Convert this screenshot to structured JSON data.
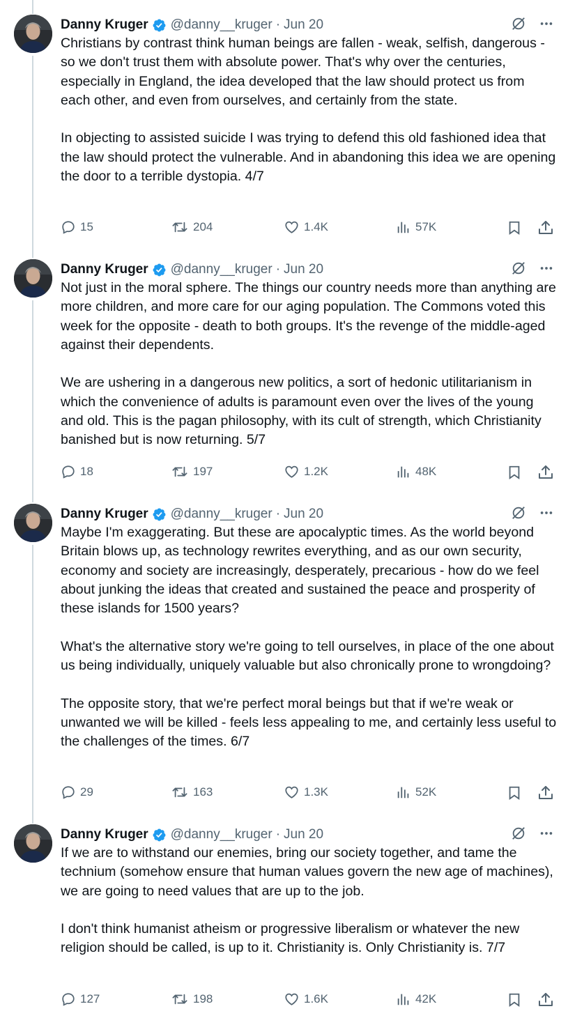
{
  "tweets": [
    {
      "name": "Danny Kruger",
      "handle": "@danny__kruger",
      "separator": "·",
      "date": "Jun 20",
      "paragraphs": [
        "Christians by contrast think human beings are fallen - weak, selfish, dangerous - so we don't trust them with absolute power. That's why over the centuries, especially in England, the idea developed that the law should protect us from each other, and even from ourselves, and certainly from the state.",
        "In objecting to assisted suicide I was trying to defend this old fashioned idea that the law should protect the vulnerable. And in abandoning this idea we are opening the door to a terrible dystopia. 4/7"
      ],
      "replies": "15",
      "reposts": "204",
      "likes": "1.4K",
      "views": "57K"
    },
    {
      "name": "Danny Kruger",
      "handle": "@danny__kruger",
      "separator": "·",
      "date": "Jun 20",
      "paragraphs": [
        "Not just in the moral sphere. The things our country needs more than anything are more children, and more care for our aging population. The Commons voted this week for the opposite - death to both groups. It's the revenge of the middle-aged against their dependents.",
        "We are ushering in a dangerous new politics, a sort of hedonic utilitarianism in which the convenience of adults is paramount even over the lives of the young and old. This is the pagan philosophy, with its cult of strength, which Christianity banished but is now returning. 5/7"
      ],
      "replies": "18",
      "reposts": "197",
      "likes": "1.2K",
      "views": "48K"
    },
    {
      "name": "Danny Kruger",
      "handle": "@danny__kruger",
      "separator": "·",
      "date": "Jun 20",
      "paragraphs": [
        "Maybe I'm exaggerating. But these are apocalyptic times. As the world beyond Britain blows up, as technology rewrites everything, and as our own security, economy and society are increasingly, desperately, precarious - how do we feel about junking the ideas that created and sustained the peace and prosperity of these islands for 1500 years?",
        "What's the alternative story we're going to tell ourselves, in place of the one about us being individually, uniquely valuable but also chronically prone to wrongdoing?",
        "The opposite story, that we're perfect moral beings but that if we're weak or unwanted we will be killed - feels less appealing to me, and certainly less useful to the challenges of the times. 6/7"
      ],
      "replies": "29",
      "reposts": "163",
      "likes": "1.3K",
      "views": "52K"
    },
    {
      "name": "Danny Kruger",
      "handle": "@danny__kruger",
      "separator": "·",
      "date": "Jun 20",
      "paragraphs": [
        "If we are to withstand our enemies, bring our society together, and tame the technium (somehow ensure that human values govern the new age of machines), we are going to need values that are up to the job.",
        "I don't think humanist atheism or progressive liberalism or whatever the new religion should be called, is up to it. Christianity is. Only Christianity is. 7/7"
      ],
      "replies": "127",
      "reposts": "198",
      "likes": "1.6K",
      "views": "42K"
    }
  ],
  "icons": {
    "verified": "verified-badge-icon",
    "grok": "grok-icon",
    "more": "more-icon",
    "reply": "reply-icon",
    "repost": "repost-icon",
    "like": "like-icon",
    "views": "views-icon",
    "bookmark": "bookmark-icon",
    "share": "share-icon"
  },
  "colors": {
    "text": "#0f1419",
    "secondary": "#536471",
    "verified": "#1d9bf0",
    "thread_line": "#cfd9de"
  }
}
